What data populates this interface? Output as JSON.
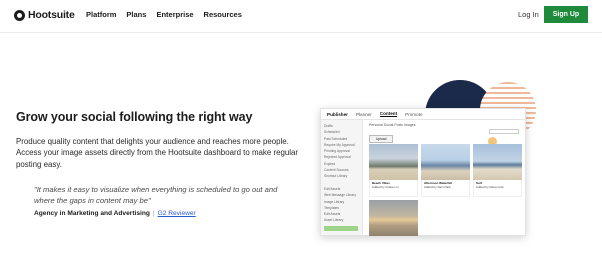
{
  "brand": {
    "name": "Hootsuite",
    "icon": "owl-logo-icon"
  },
  "nav": {
    "links": [
      "Platform",
      "Plans",
      "Enterprise",
      "Resources"
    ],
    "login": "Log In",
    "signup": "Sign Up",
    "signup_color": "#1f8a3b"
  },
  "hero": {
    "headline": "Grow your social following the right way",
    "body": "Produce quality content that delights your audience and reaches more people. Access your image assets directly from the Hootsuite dashboard to make regular posting easy.",
    "quote": "\"It makes it easy to visualize when everything is scheduled to go out and where the gaps in content may be\"",
    "attribution": "Agency in Marketing and Advertising",
    "separator": "|",
    "source_link": "G2 Reviewer"
  },
  "dashboard": {
    "tabs": {
      "brand": "Publisher",
      "items": [
        "Planner",
        "Content",
        "Promote"
      ],
      "active": "Content"
    },
    "sidebar_items": [
      "Drafts",
      "Scheduled",
      "Past Scheduled",
      "Require My Approval",
      "Pending Approval",
      "Rejected Approval",
      "Expired",
      "Content Sources",
      "Shortcut Library",
      "",
      "Edit Assets",
      "Web Message Library",
      "Image Library",
      "Templates",
      "Edit Assets",
      "Asset Library"
    ],
    "breadcrumb": "Personal Social Posts Images",
    "upload": "Upload",
    "tiles": [
      {
        "title": "Beach Vibes",
        "line": "Added by Grace Lin"
      },
      {
        "title": "Afternoon Waterfall",
        "line": "Added by Sam Park"
      },
      {
        "title": "Surf",
        "line": "Added by Dana Cole"
      },
      {
        "title": "",
        "line": ""
      }
    ],
    "colors": {
      "sidebar_button": "#9ed38a",
      "badge": "#f3c47e"
    }
  },
  "decor": {
    "navy": "#1b2a4a",
    "stripe": "#f0b89a"
  }
}
